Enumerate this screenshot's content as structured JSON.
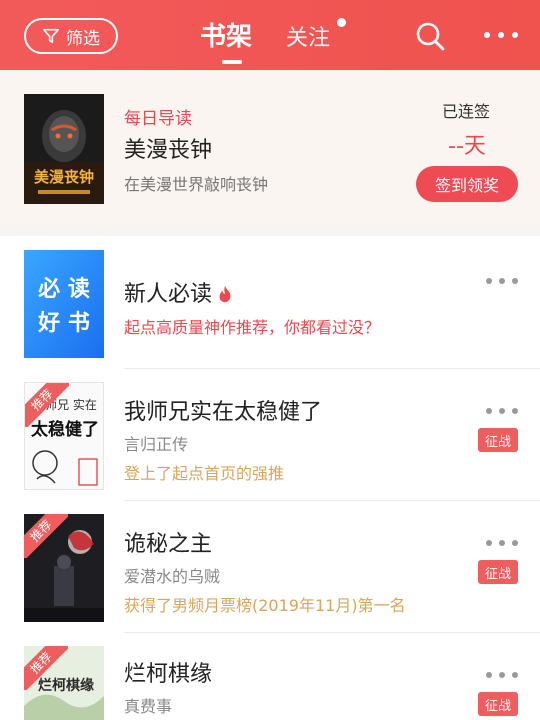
{
  "header": {
    "filter_label": "筛选",
    "tab_shelf": "书架",
    "tab_follow": "关注",
    "search_icon": "search-icon",
    "more_icon": "more-icon",
    "bg_color": "#f25a5a"
  },
  "daily": {
    "tag": "每日导读",
    "title": "美漫丧钟",
    "desc": "在美漫世界敲响丧钟",
    "cover_text": "美漫丧钟",
    "streak_label": "已连签",
    "streak_value": "--天",
    "checkin_label": "签到领奖"
  },
  "items": [
    {
      "title": "新人必读",
      "note": "起点高质量神作推荐，你都看过没？",
      "cover_lines": [
        "必 读",
        "好 书"
      ]
    },
    {
      "title": "我师兄实在太稳健了",
      "author": "言归正传",
      "note": "登上了起点首页的强推",
      "badge": "征战",
      "ribbon": "推荐",
      "cover_lines": [
        "师兄 实在",
        "太稳健了"
      ]
    },
    {
      "title": "诡秘之主",
      "author": "爱潜水的乌贼",
      "note": "获得了男频月票榜(2019年11月)第一名",
      "badge": "征战",
      "ribbon": "推荐"
    },
    {
      "title": "烂柯棋缘",
      "author": "真费事",
      "badge": "征战",
      "ribbon": "推荐",
      "cover_lines": [
        "烂柯棋缘"
      ]
    }
  ]
}
